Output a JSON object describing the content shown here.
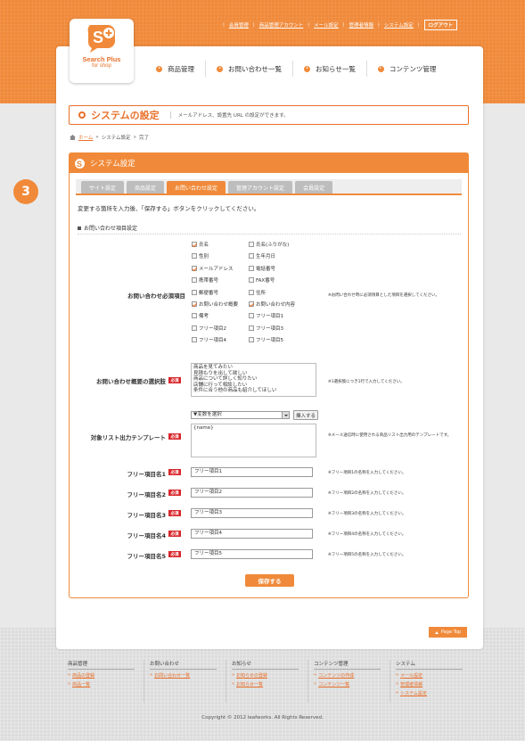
{
  "header": {
    "toplinks": [
      "会員管理",
      "商品管理アカウント",
      "メール設定",
      "管理者情報",
      "システム設定"
    ],
    "logout": "ログアウト",
    "logo_line1": "Search Plus",
    "logo_line2": "for shop"
  },
  "nav": [
    "商品管理",
    "お問い合わせ一覧",
    "お知らせ一覧",
    "コンテンツ管理"
  ],
  "title": {
    "text": "システムの設定",
    "sub": "メールアドレス、設置先 URL の設定ができます。"
  },
  "breadcrumb": {
    "home": "ホーム",
    "sep": "»",
    "current": "システム設定",
    "status": "完了"
  },
  "step": "3",
  "panel": {
    "heading": "システム設定",
    "tabs": [
      "サイト設定",
      "商品設定",
      "お問い合わせ設定",
      "管理アカウント設定",
      "会員設定"
    ],
    "active_tab": 2,
    "intro": "変更する箇所を入力後、「保存する」ボタンをクリックしてください。",
    "section": "お問い合わせ項目設定",
    "required_label": "必須"
  },
  "required_fields": {
    "label": "お問い合わせ必須項目",
    "note": "※お問い合わせ時に必須項目とした項目を選択してください。",
    "items": [
      {
        "label": "氏名",
        "checked": true
      },
      {
        "label": "氏名(ふりがな)",
        "checked": false
      },
      {
        "label": "性別",
        "checked": false
      },
      {
        "label": "生年月日",
        "checked": false
      },
      {
        "label": "メールアドレス",
        "checked": true
      },
      {
        "label": "電話番号",
        "checked": false
      },
      {
        "label": "携帯番号",
        "checked": false
      },
      {
        "label": "FAX番号",
        "checked": false
      },
      {
        "label": "郵便番号",
        "checked": false
      },
      {
        "label": "住所",
        "checked": false
      },
      {
        "label": "お問い合わせ概要",
        "checked": true
      },
      {
        "label": "お問い合わせ内容",
        "checked": true
      },
      {
        "label": "備考",
        "checked": false
      },
      {
        "label": "フリー項目1",
        "checked": false
      },
      {
        "label": "フリー項目2",
        "checked": false
      },
      {
        "label": "フリー項目3",
        "checked": false
      },
      {
        "label": "フリー項目4",
        "checked": false
      },
      {
        "label": "フリー項目5",
        "checked": false
      }
    ]
  },
  "summary_options": {
    "label": "お問い合わせ概要の選択肢",
    "value": "商品を見てみたい\n見積もりを出して欲しい\n商品について詳しく知りたい\n店舗に行って相談したい\n条件に合う他の商品も紹介してほしい",
    "note": "※1選択肢につき1行で入力してください。"
  },
  "template": {
    "label": "対象リスト出力テンプレート",
    "select_value": "▼変数を選択",
    "insert_button": "挿入する",
    "value": "{name}",
    "note": "※メール送信時に使用される商品リスト出力用のテンプレートです。"
  },
  "free_items": [
    {
      "label": "フリー項目名1",
      "value": "フリー項目1",
      "note": "※フリー項目1の名称を入力してください。"
    },
    {
      "label": "フリー項目名2",
      "value": "フリー項目2",
      "note": "※フリー項目2の名称を入力してください。"
    },
    {
      "label": "フリー項目名3",
      "value": "フリー項目3",
      "note": "※フリー項目3の名称を入力してください。"
    },
    {
      "label": "フリー項目名4",
      "value": "フリー項目4",
      "note": "※フリー項目4の名称を入力してください。"
    },
    {
      "label": "フリー項目名5",
      "value": "フリー項目5",
      "note": "※フリー項目5の名称を入力してください。"
    }
  ],
  "save_button": "保存する",
  "page_top": "Page Top",
  "footer": {
    "columns": [
      {
        "head": "商品管理",
        "links": [
          "商品の登録",
          "商品一覧"
        ]
      },
      {
        "head": "お問い合わせ",
        "links": [
          "お問い合わせ一覧"
        ]
      },
      {
        "head": "お知らせ",
        "links": [
          "お知らせの登録",
          "お知らせ一覧"
        ]
      },
      {
        "head": "コンテンツ管理",
        "links": [
          "コンテンツの作成",
          "コンテンツ一覧"
        ]
      },
      {
        "head": "システム",
        "links": [
          "メール設定",
          "管理者情報",
          "システム設定"
        ]
      }
    ],
    "copyright": "Copyright © 2012 leafworks. All Rights Reserved."
  },
  "colors": {
    "accent": "#f08a3a",
    "required": "#d8262b"
  }
}
